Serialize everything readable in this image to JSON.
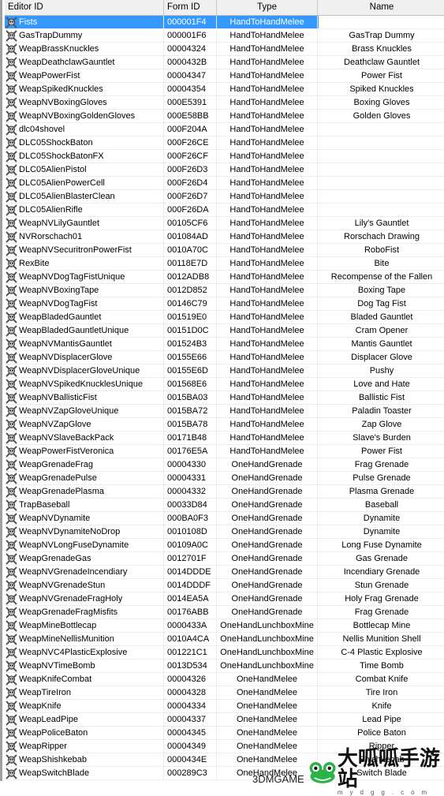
{
  "columns": [
    "Editor ID",
    "Form ID",
    "Type",
    "Name"
  ],
  "selected_row": 0,
  "colors": {
    "selection": "#3399ff",
    "header_bg": "#f0f0f0"
  },
  "row_icon": "weapon-skull-crossbones-icon",
  "rows": [
    [
      "Fists",
      "000001F4",
      "HandToHandMelee",
      ""
    ],
    [
      "GasTrapDummy",
      "000001F6",
      "HandToHandMelee",
      "GasTrap Dummy"
    ],
    [
      "WeapBrassKnuckles",
      "00004324",
      "HandToHandMelee",
      "Brass Knuckles"
    ],
    [
      "WeapDeathclawGauntlet",
      "0000432B",
      "HandToHandMelee",
      "Deathclaw Gauntlet"
    ],
    [
      "WeapPowerFist",
      "00004347",
      "HandToHandMelee",
      "Power Fist"
    ],
    [
      "WeapSpikedKnuckles",
      "00004354",
      "HandToHandMelee",
      "Spiked Knuckles"
    ],
    [
      "WeapNVBoxingGloves",
      "000E5391",
      "HandToHandMelee",
      "Boxing Gloves"
    ],
    [
      "WeapNVBoxingGoldenGloves",
      "000E58BB",
      "HandToHandMelee",
      "Golden Gloves"
    ],
    [
      "dlc04shovel",
      "000F204A",
      "HandToHandMelee",
      ""
    ],
    [
      "DLC05ShockBaton",
      "000F26CE",
      "HandToHandMelee",
      ""
    ],
    [
      "DLC05ShockBatonFX",
      "000F26CF",
      "HandToHandMelee",
      ""
    ],
    [
      "DLC05AlienPistol",
      "000F26D3",
      "HandToHandMelee",
      ""
    ],
    [
      "DLC05AlienPowerCell",
      "000F26D4",
      "HandToHandMelee",
      ""
    ],
    [
      "DLC05AlienBlasterClean",
      "000F26D7",
      "HandToHandMelee",
      ""
    ],
    [
      "DLC05AlienRifle",
      "000F26DA",
      "HandToHandMelee",
      ""
    ],
    [
      "WeapNVLilyGauntlet",
      "00105CF6",
      "HandToHandMelee",
      "Lily's Gauntlet"
    ],
    [
      "NVRorschach01",
      "001084AD",
      "HandToHandMelee",
      "Rorschach Drawing"
    ],
    [
      "WeapNVSecuritronPowerFist",
      "0010A70C",
      "HandToHandMelee",
      "RoboFist"
    ],
    [
      "RexBite",
      "00118E7D",
      "HandToHandMelee",
      "Bite"
    ],
    [
      "WeapNVDogTagFistUnique",
      "0012ADB8",
      "HandToHandMelee",
      "Recompense of the Fallen"
    ],
    [
      "WeapNVBoxingTape",
      "0012D852",
      "HandToHandMelee",
      "Boxing Tape"
    ],
    [
      "WeapNVDogTagFist",
      "00146C79",
      "HandToHandMelee",
      "Dog Tag Fist"
    ],
    [
      "WeapBladedGauntlet",
      "001519E0",
      "HandToHandMelee",
      "Bladed Gauntlet"
    ],
    [
      "WeapBladedGauntletUnique",
      "00151D0C",
      "HandToHandMelee",
      "Cram Opener"
    ],
    [
      "WeapNVMantisGauntlet",
      "001524B3",
      "HandToHandMelee",
      "Mantis Gauntlet"
    ],
    [
      "WeapNVDisplacerGlove",
      "00155E66",
      "HandToHandMelee",
      "Displacer Glove"
    ],
    [
      "WeapNVDisplacerGloveUnique",
      "00155E6D",
      "HandToHandMelee",
      "Pushy"
    ],
    [
      "WeapNVSpikedKnucklesUnique",
      "001568E6",
      "HandToHandMelee",
      "Love and Hate"
    ],
    [
      "WeapNVBallisticFist",
      "0015BA03",
      "HandToHandMelee",
      "Ballistic Fist"
    ],
    [
      "WeapNVZapGloveUnique",
      "0015BA72",
      "HandToHandMelee",
      "Paladin Toaster"
    ],
    [
      "WeapNVZapGlove",
      "0015BA78",
      "HandToHandMelee",
      "Zap Glove"
    ],
    [
      "WeapNVSlaveBackPack",
      "00171B48",
      "HandToHandMelee",
      "Slave's Burden"
    ],
    [
      "WeapPowerFistVeronica",
      "00176E5A",
      "HandToHandMelee",
      "Power Fist"
    ],
    [
      "WeapGrenadeFrag",
      "00004330",
      "OneHandGrenade",
      "Frag Grenade"
    ],
    [
      "WeapGrenadePulse",
      "00004331",
      "OneHandGrenade",
      "Pulse Grenade"
    ],
    [
      "WeapGrenadePlasma",
      "00004332",
      "OneHandGrenade",
      "Plasma Grenade"
    ],
    [
      "TrapBaseball",
      "00033D84",
      "OneHandGrenade",
      "Baseball"
    ],
    [
      "WeapNVDynamite",
      "000BA0F3",
      "OneHandGrenade",
      "Dynamite"
    ],
    [
      "WeapNVDynamiteNoDrop",
      "0010108D",
      "OneHandGrenade",
      "Dynamite"
    ],
    [
      "WeapNVLongFuseDynamite",
      "00109A0C",
      "OneHandGrenade",
      "Long Fuse Dynamite"
    ],
    [
      "WeapGrenadeGas",
      "0012701F",
      "OneHandGrenade",
      "Gas Grenade"
    ],
    [
      "WeapNVGrenadeIncendiary",
      "0014DDDE",
      "OneHandGrenade",
      "Incendiary Grenade"
    ],
    [
      "WeapNVGrenadeStun",
      "0014DDDF",
      "OneHandGrenade",
      "Stun Grenade"
    ],
    [
      "WeapNVGrenadeFragHoly",
      "0014EA5A",
      "OneHandGrenade",
      "Holy Frag Grenade"
    ],
    [
      "WeapGrenadeFragMisfits",
      "00176ABB",
      "OneHandGrenade",
      "Frag Grenade"
    ],
    [
      "WeapMineBottlecap",
      "0000433A",
      "OneHandLunchboxMine",
      "Bottlecap Mine"
    ],
    [
      "WeapMineNellisMunition",
      "0010A4CA",
      "OneHandLunchboxMine",
      "Nellis Munition Shell"
    ],
    [
      "WeapNVC4PlasticExplosive",
      "001221C1",
      "OneHandLunchboxMine",
      "C-4 Plastic Explosive"
    ],
    [
      "WeapNVTimeBomb",
      "0013D534",
      "OneHandLunchboxMine",
      "Time Bomb"
    ],
    [
      "WeapKnifeCombat",
      "00004326",
      "OneHandMelee",
      "Combat Knife"
    ],
    [
      "WeapTireIron",
      "00004328",
      "OneHandMelee",
      "Tire Iron"
    ],
    [
      "WeapKnife",
      "00004334",
      "OneHandMelee",
      "Knife"
    ],
    [
      "WeapLeadPipe",
      "00004337",
      "OneHandMelee",
      "Lead Pipe"
    ],
    [
      "WeapPoliceBaton",
      "00004345",
      "OneHandMelee",
      "Police Baton"
    ],
    [
      "WeapRipper",
      "00004349",
      "OneHandMelee",
      "Ripper"
    ],
    [
      "WeapShishkebab",
      "0000434E",
      "OneHandMelee",
      "Shishkebab"
    ],
    [
      "WeapSwitchBlade",
      "000289C3",
      "OneHandMelee",
      "Switch Blade"
    ]
  ],
  "watermark": {
    "left": "3DMGAME",
    "right": "大呱呱手游站",
    "url": "mydgg.com"
  }
}
